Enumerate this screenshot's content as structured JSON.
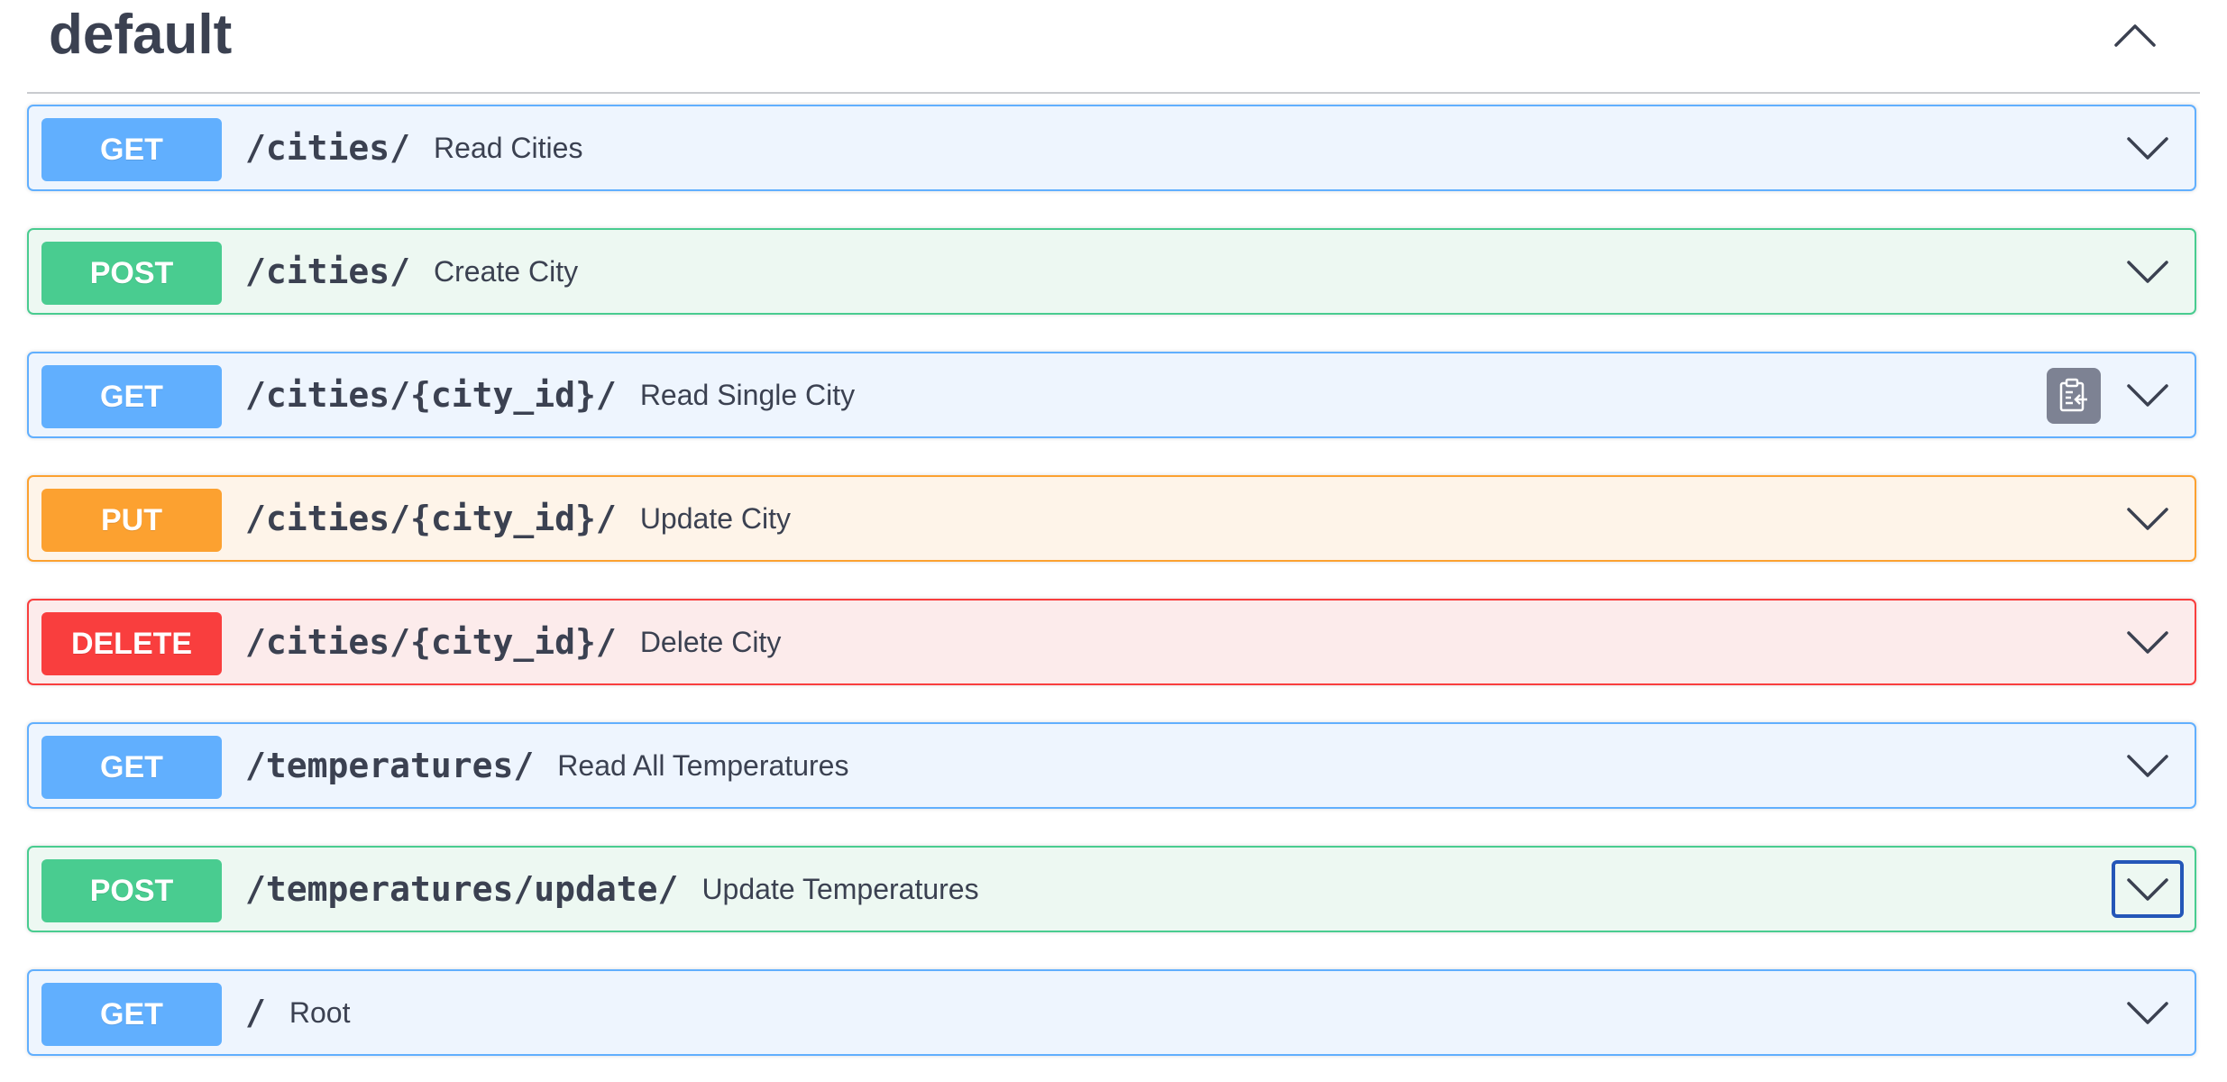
{
  "tag": {
    "title": "default"
  },
  "operations": [
    {
      "method": "GET",
      "kind": "get",
      "path": "/cities/",
      "summary": "Read Cities"
    },
    {
      "method": "POST",
      "kind": "post",
      "path": "/cities/",
      "summary": "Create City"
    },
    {
      "method": "GET",
      "kind": "get",
      "path": "/cities/{city_id}/",
      "summary": "Read Single City"
    },
    {
      "method": "PUT",
      "kind": "put",
      "path": "/cities/{city_id}/",
      "summary": "Update City"
    },
    {
      "method": "DELETE",
      "kind": "delete",
      "path": "/cities/{city_id}/",
      "summary": "Delete City"
    },
    {
      "method": "GET",
      "kind": "get",
      "path": "/temperatures/",
      "summary": "Read All Temperatures"
    },
    {
      "method": "POST",
      "kind": "post",
      "path": "/temperatures/update/",
      "summary": "Update Temperatures"
    },
    {
      "method": "GET",
      "kind": "get",
      "path": "/",
      "summary": "Root"
    }
  ],
  "colors": {
    "get": "#61affe",
    "post": "#49cc90",
    "put": "#fca130",
    "delete": "#f93e3e",
    "focus_ring": "#2456b8"
  },
  "icons": {
    "collapse": "chevron-up-icon",
    "expand": "chevron-down-icon",
    "copy": "clipboard-copy-icon"
  }
}
